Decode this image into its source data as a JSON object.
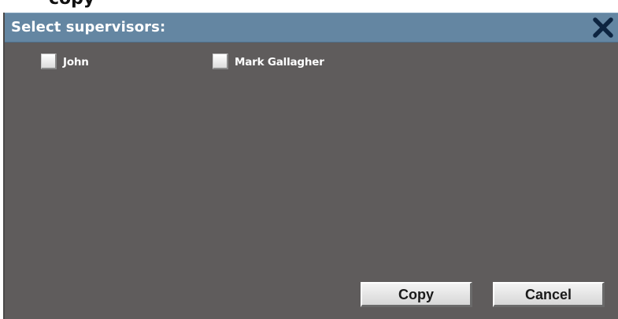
{
  "page_fragment": {
    "cut_title": "copy"
  },
  "dialog": {
    "title": "Select supervisors:",
    "close_icon": "close-icon",
    "options": [
      {
        "label": "John",
        "checked": false
      },
      {
        "label": "Mark Gallagher",
        "checked": false
      }
    ],
    "buttons": {
      "copy_label": "Copy",
      "cancel_label": "Cancel"
    }
  },
  "colors": {
    "titlebar": "#6486a2",
    "dialog_body": "#5f5c5c",
    "title_text": "#ffffff",
    "close_icon": "#0d2440"
  }
}
